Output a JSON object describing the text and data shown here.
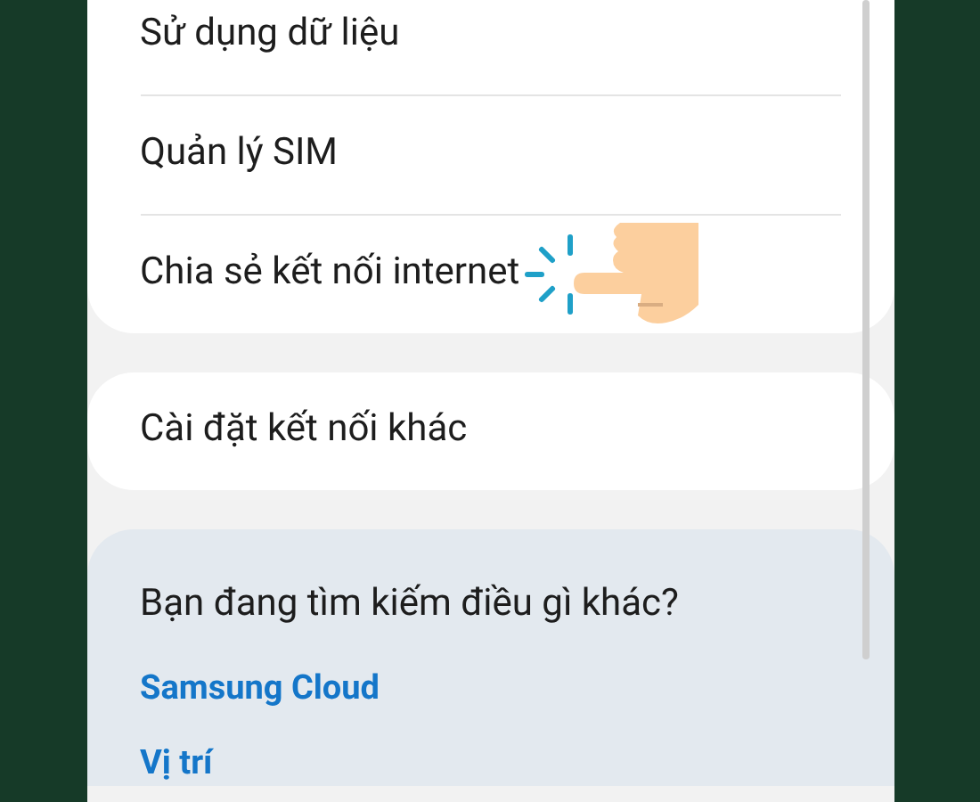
{
  "sections": [
    {
      "items": [
        {
          "label": "Sử dụng dữ liệu",
          "pointed": false
        },
        {
          "label": "Quản lý SIM",
          "pointed": false
        },
        {
          "label": "Chia sẻ kết nối internet",
          "pointed": true
        }
      ]
    },
    {
      "items": [
        {
          "label": "Cài đặt kết nối khác",
          "pointed": false
        }
      ]
    }
  ],
  "suggestions": {
    "title": "Bạn đang tìm kiếm điều gì khác?",
    "links": [
      "Samsung Cloud",
      "Vị trí"
    ]
  }
}
